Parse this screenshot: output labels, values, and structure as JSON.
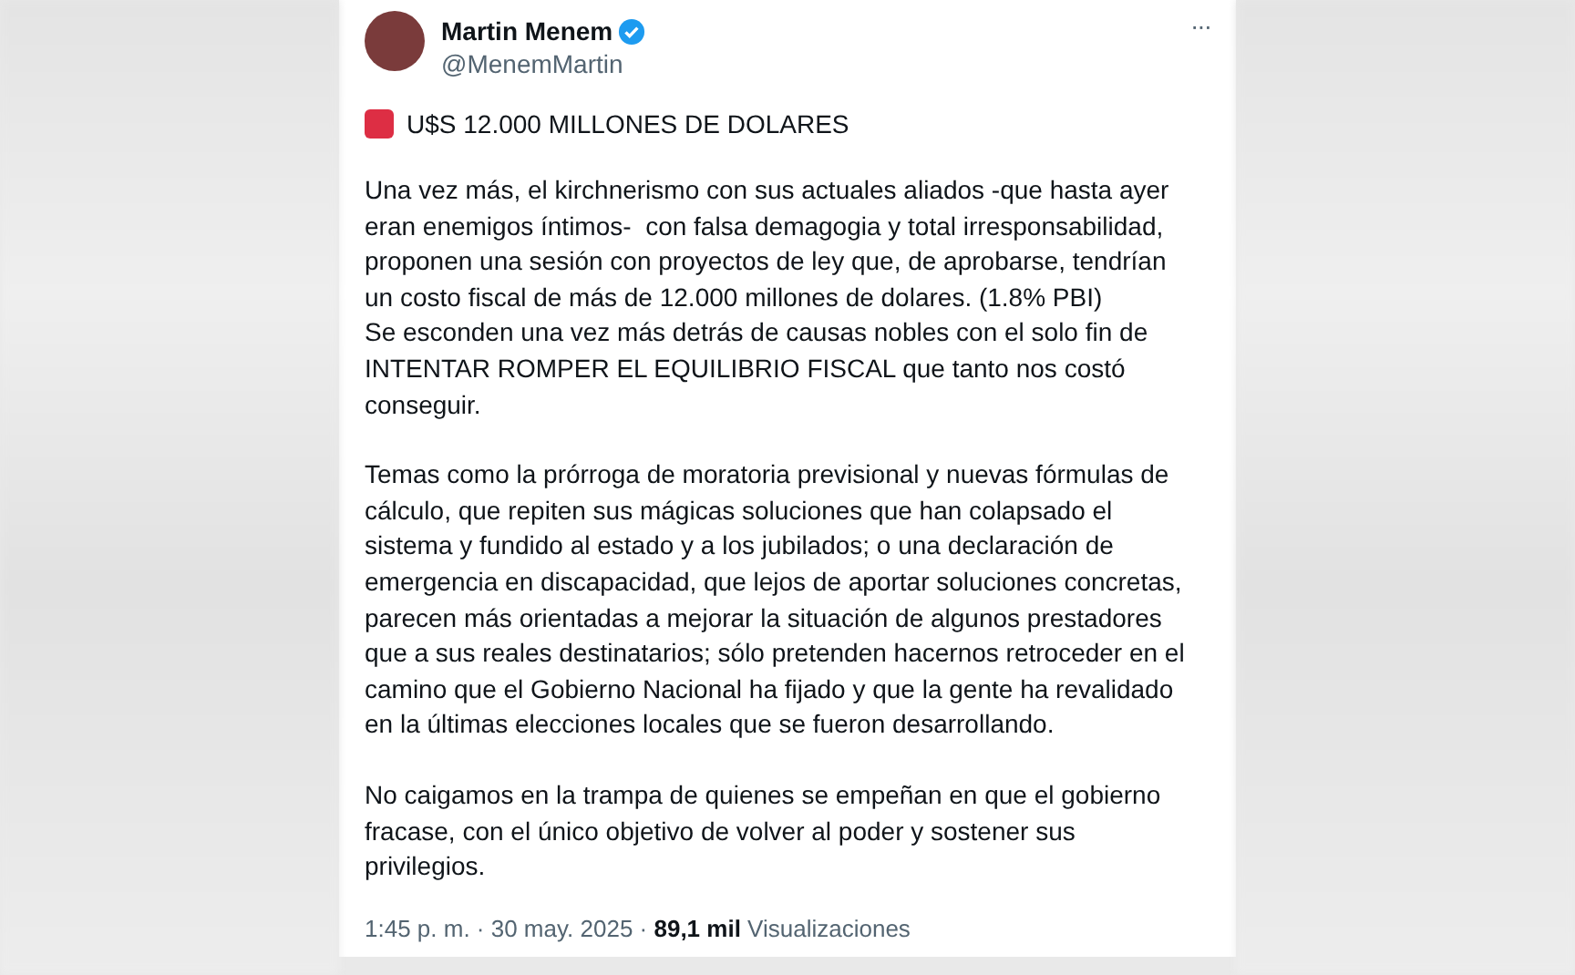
{
  "author": {
    "name": "Martin Menem",
    "handle": "@MenemMartin",
    "verified": true
  },
  "more": "···",
  "headline": "U$S 12.000 MILLONES DE DOLARES",
  "paragraphs": [
    "Una vez más, el kirchnerismo con sus actuales aliados -que hasta ayer\neran enemigos íntimos-  con falsa demagogia y total irresponsabilidad,\nproponen una sesión con proyectos de ley que, de aprobarse, tendrían\nun costo fiscal de más de 12.000 millones de dolares. (1.8% PBI)\nSe esconden una vez más detrás de causas nobles con el solo fin de\nINTENTAR ROMPER EL EQUILIBRIO FISCAL que tanto nos costó\nconseguir.",
    "Temas como la prórroga de moratoria previsional y nuevas fórmulas de\ncálculo, que repiten sus mágicas soluciones que han colapsado el\nsistema y fundido al estado y a los jubilados; o una declaración de\nemergencia en discapacidad, que lejos de aportar soluciones concretas,\nparecen más orientadas a mejorar la situación de algunos prestadores\nque a sus reales destinatarios; sólo pretenden hacernos retroceder en el\ncamino que el Gobierno Nacional ha fijado y que la gente ha revalidado\nen la últimas elecciones locales que se fueron desarrollando.",
    "No caigamos en la trampa de quienes se empeñan en que el gobierno\nfracase, con el único objetivo de volver al poder y sostener sus\nprivilegios."
  ],
  "meta": "1:45 p. m. · 30 may. 2025 · **89,1 mil** Visualizaciones"
}
